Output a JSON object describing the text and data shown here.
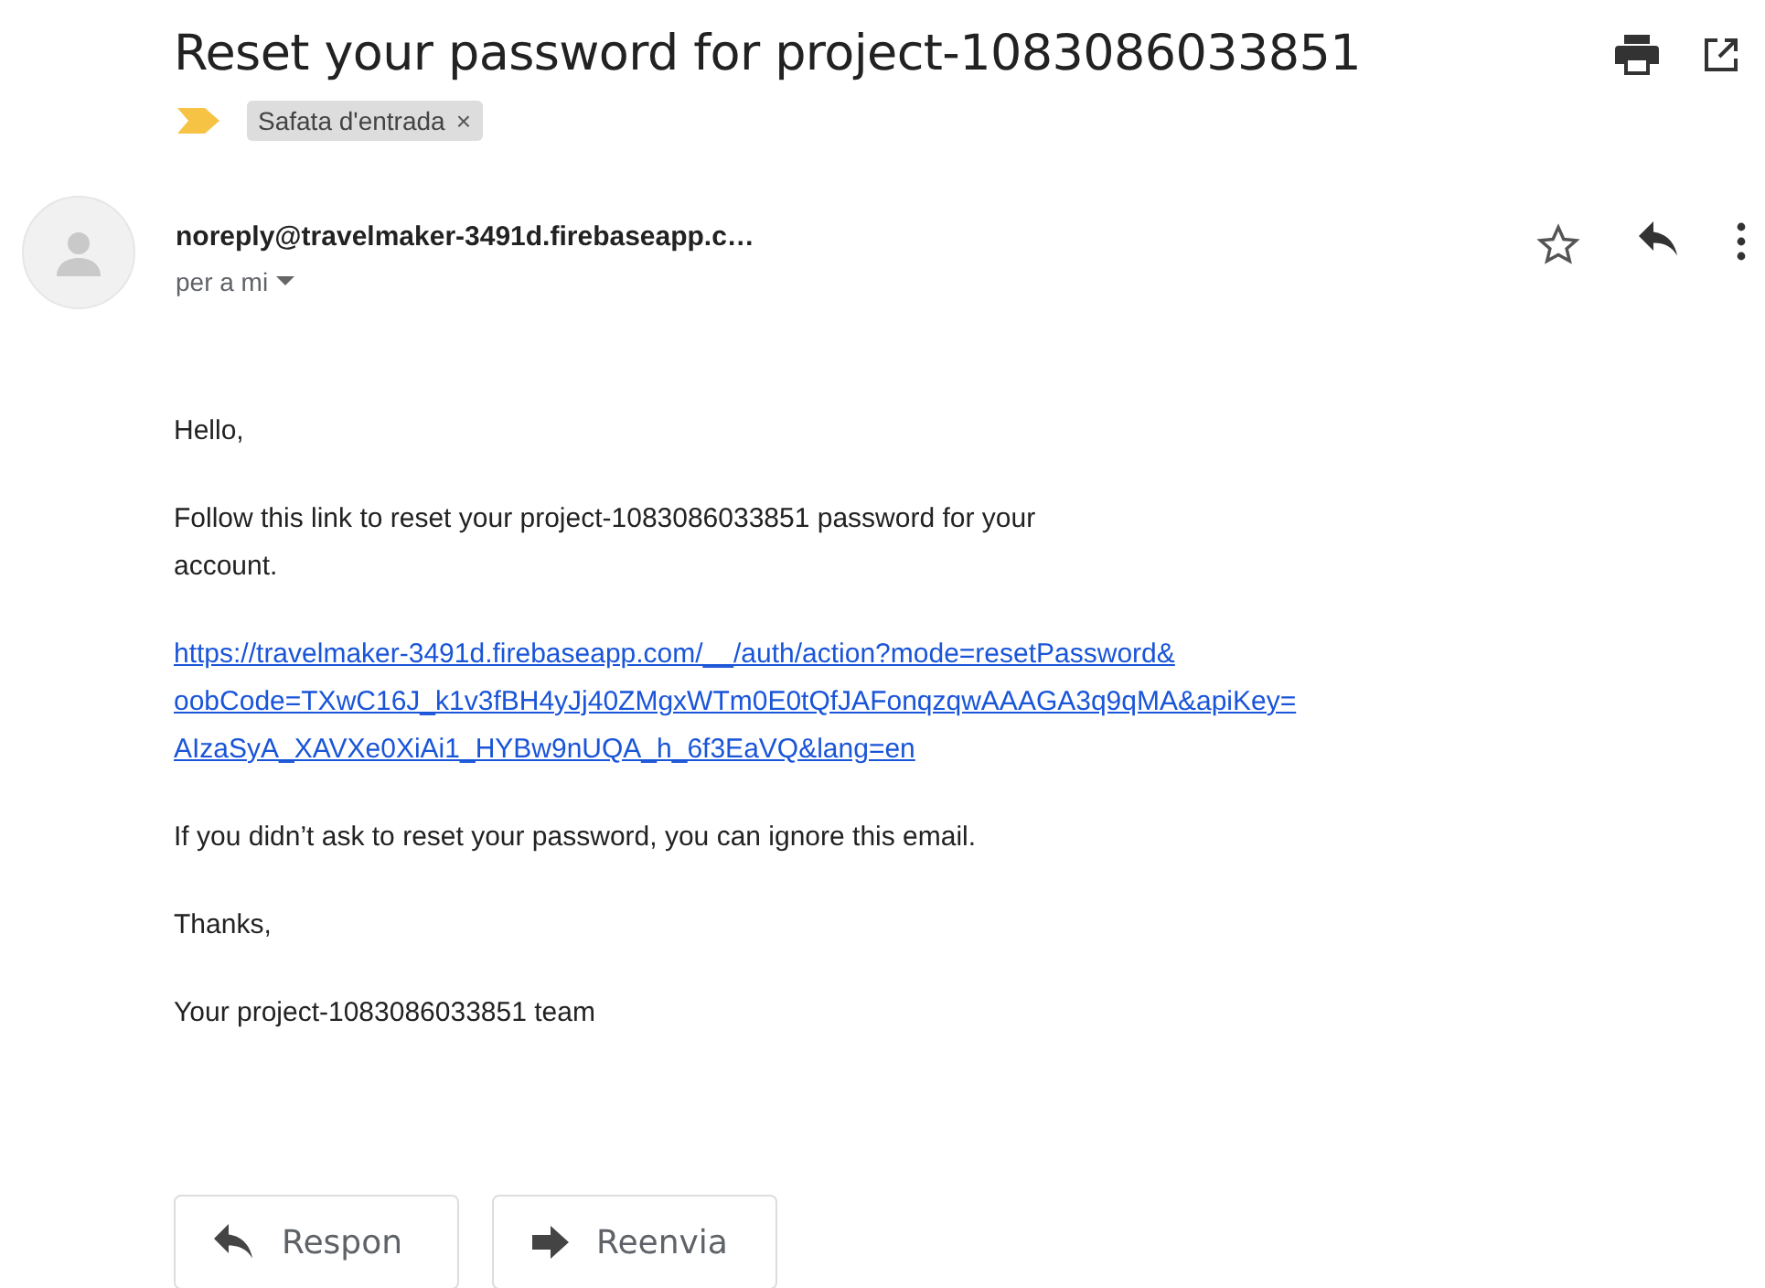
{
  "subject": "Reset your password for project-1083086033851",
  "labels": [
    {
      "text": "Safata d'entrada",
      "remove": "×"
    }
  ],
  "sender": {
    "address": "noreply@travelmaker-3491d.firebaseapp.c…",
    "recipient": "per a mi"
  },
  "starred": false,
  "body": {
    "greeting": "Hello,",
    "intro_lines": [
      "Follow this link to reset your project-1083086033851 password for your",
      "account."
    ],
    "link_lines": [
      "https://travelmaker-3491d.firebaseapp.com/__/auth/action?mode=resetPassword&",
      "oobCode=TXwC16J_k1v3fBH4yJj40ZMgxWTm0E0tQfJAFonqzqwAAAGA3q9qMA&apiKey=",
      "AIzaSyA_XAVXe0XiAi1_HYBw9nUQA_h_6f3EaVQ&lang=en"
    ],
    "ignore": "If you didn’t ask to reset your password, you can ignore this email.",
    "thanks": "Thanks,",
    "signature": "Your project-1083086033851 team"
  },
  "actions": [
    {
      "kind": "reply",
      "label": "Respon"
    },
    {
      "kind": "forward",
      "label": "Reenvia"
    }
  ]
}
